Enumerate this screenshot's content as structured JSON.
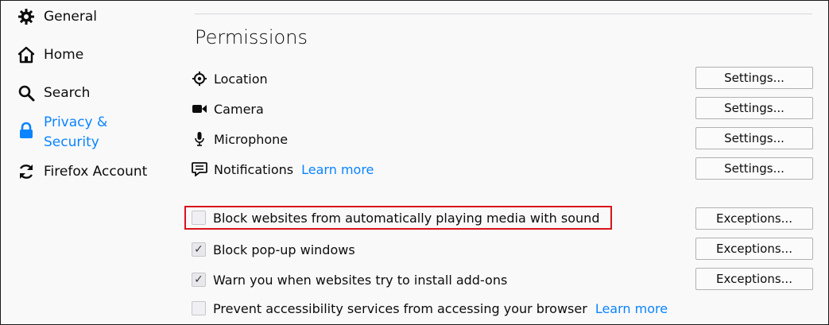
{
  "sidebar": {
    "items": [
      {
        "label": "General",
        "icon": "gear-icon"
      },
      {
        "label": "Home",
        "icon": "home-icon"
      },
      {
        "label": "Search",
        "icon": "search-icon"
      },
      {
        "label": "Privacy & Security",
        "icon": "lock-icon",
        "selected": true
      },
      {
        "label": "Firefox Account",
        "icon": "sync-icon"
      }
    ]
  },
  "permissions": {
    "title": "Permissions",
    "rows": [
      {
        "label": "Location",
        "icon": "location-icon",
        "button": "Settings..."
      },
      {
        "label": "Camera",
        "icon": "camera-icon",
        "button": "Settings..."
      },
      {
        "label": "Microphone",
        "icon": "microphone-icon",
        "button": "Settings..."
      },
      {
        "label": "Notifications",
        "icon": "notifications-icon",
        "button": "Settings...",
        "learn_more": "Learn more"
      }
    ],
    "checks": [
      {
        "label": "Block websites from automatically playing media with sound",
        "checked": false,
        "button": "Exceptions...",
        "highlighted": true
      },
      {
        "label": "Block pop-up windows",
        "checked": true,
        "button": "Exceptions..."
      },
      {
        "label": "Warn you when websites try to install add-ons",
        "checked": true,
        "button": "Exceptions..."
      },
      {
        "label": "Prevent accessibility services from accessing your browser",
        "checked": false,
        "learn_more": "Learn more"
      }
    ]
  },
  "colors": {
    "accent": "#0a84ff",
    "highlight": "#d7141a",
    "background": "#f9f9fa"
  }
}
